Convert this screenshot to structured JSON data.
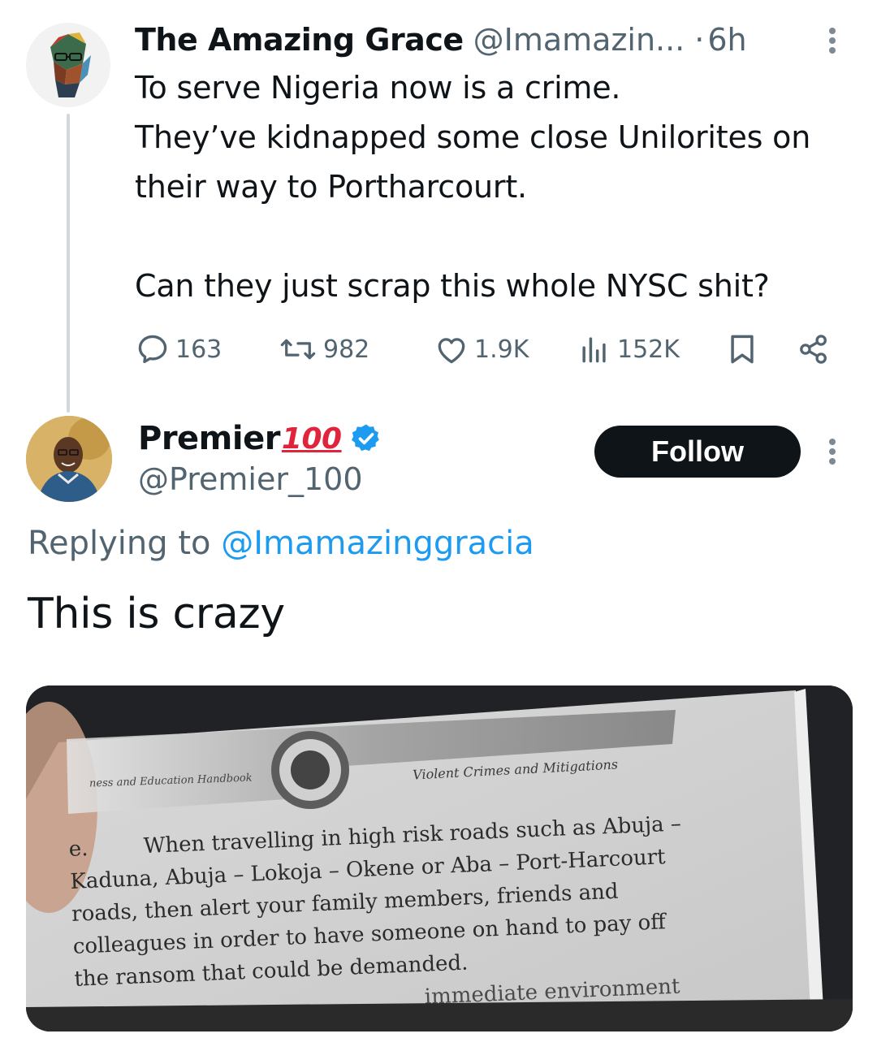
{
  "original_tweet": {
    "author_name": "The Amazing Grace",
    "author_handle": "@Imamazin...",
    "separator": "·",
    "time": "6h",
    "text": "To serve Nigeria now is a crime.\nThey’ve kidnapped some close Unilorites on their way to Portharcourt.\n\nCan they just scrap this whole NYSC shit?",
    "stats": {
      "replies": "163",
      "retweets": "982",
      "likes": "1.9K",
      "views": "152K"
    },
    "icons": [
      "reply-icon",
      "retweet-icon",
      "like-icon",
      "views-icon",
      "bookmark-icon",
      "share-icon",
      "more-icon"
    ]
  },
  "reply_tweet": {
    "author_name": "Premier",
    "author_name_emoji": "100",
    "verified": true,
    "author_handle": "@Premier_100",
    "follow_label": "Follow",
    "replying_prefix": "Replying to ",
    "replying_to": "@Imamazinggracia",
    "text": "This is crazy"
  },
  "photo": {
    "header_left": "ness and Education Handbook",
    "header_right": "Violent Crimes and Mitigations",
    "item_label": "e.",
    "lines": [
      "When travelling in high risk roads such as Abuja –",
      "Kaduna, Abuja – Lokoja – Okene or Aba – Port-Harcourt",
      "roads, then alert your family members, friends and",
      "colleagues in order to have someone on hand to pay off",
      "the ransom that could be demanded."
    ],
    "cut_line": "immediate environment"
  },
  "colors": {
    "text": "#0f1419",
    "muted": "#536471",
    "link": "#1d9bf0",
    "verified": "#1d9bf0",
    "follow_bg": "#0f1419",
    "thread_line": "#cfd9de"
  }
}
